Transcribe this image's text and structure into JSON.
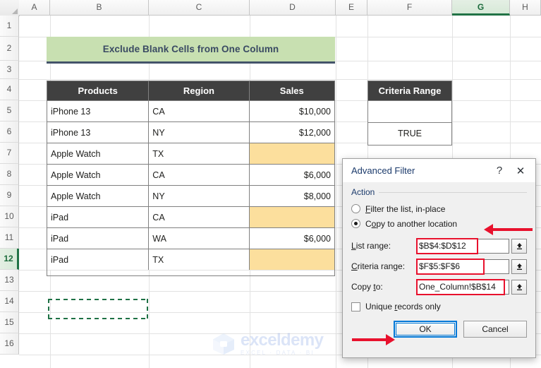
{
  "spreadsheet": {
    "column_headers": [
      "A",
      "B",
      "C",
      "D",
      "E",
      "F",
      "G",
      "H"
    ],
    "selected_column": "G",
    "row_headers": [
      "1",
      "2",
      "3",
      "4",
      "5",
      "6",
      "7",
      "8",
      "9",
      "10",
      "11",
      "12",
      "13",
      "14",
      "15",
      "16"
    ],
    "selected_row": "12",
    "title_banner": "Exclude Blank Cells from One Column",
    "table": {
      "headers": [
        "Products",
        "Region",
        "Sales"
      ],
      "rows": [
        {
          "product": "iPhone 13",
          "region": "CA",
          "sales": "$10,000",
          "blank": false
        },
        {
          "product": "iPhone 13",
          "region": "NY",
          "sales": "$12,000",
          "blank": false
        },
        {
          "product": "Apple Watch",
          "region": "TX",
          "sales": "",
          "blank": true
        },
        {
          "product": "Apple Watch",
          "region": "CA",
          "sales": "$6,000",
          "blank": false
        },
        {
          "product": "Apple Watch",
          "region": "NY",
          "sales": "$8,000",
          "blank": false
        },
        {
          "product": "iPad",
          "region": "CA",
          "sales": "",
          "blank": true
        },
        {
          "product": "iPad",
          "region": "WA",
          "sales": "$6,000",
          "blank": false
        },
        {
          "product": "iPad",
          "region": "TX",
          "sales": "",
          "blank": true
        }
      ]
    },
    "criteria_range": {
      "header": "Criteria Range",
      "cells": [
        "",
        "TRUE"
      ]
    },
    "watermark": {
      "main": "exceldemy",
      "sub": "EXCEL · DATA · BI"
    },
    "colors": {
      "banner_bg": "#c8e0b1",
      "banner_text": "#3a4a63",
      "table_header_bg": "#404040",
      "blank_cell_bg": "#fcdf9d",
      "selection_green": "#217346",
      "highlight_red": "#e8112d",
      "focus_blue": "#0078d7"
    }
  },
  "dialog": {
    "title": "Advanced Filter",
    "help_icon": "?",
    "close_icon": "✕",
    "action_group_label": "Action",
    "radios": [
      {
        "label_pre": "",
        "label_accel": "F",
        "label_post": "ilter the list, in-place",
        "selected": false
      },
      {
        "label_pre": "C",
        "label_accel": "o",
        "label_post": "py to another location",
        "selected": true
      }
    ],
    "fields": [
      {
        "label_pre": "",
        "label_accel": "L",
        "label_post": "ist range:",
        "value": "$B$4:$D$12",
        "highlighted": true,
        "spinner_icon": "collapse-dialog-icon"
      },
      {
        "label_pre": "",
        "label_accel": "C",
        "label_post": "riteria range:",
        "value": "$F$5:$F$6",
        "highlighted": true,
        "spinner_icon": "collapse-dialog-icon"
      },
      {
        "label_pre": "Copy ",
        "label_accel": "t",
        "label_post": "o:",
        "value": "One_Column!$B$14",
        "highlighted": true,
        "spinner_icon": "collapse-dialog-icon"
      }
    ],
    "checkbox": {
      "label_pre": "Unique ",
      "label_accel": "r",
      "label_post": "ecords only",
      "checked": false
    },
    "buttons": [
      {
        "label": "OK",
        "focused": true
      },
      {
        "label": "Cancel",
        "focused": false
      }
    ]
  }
}
